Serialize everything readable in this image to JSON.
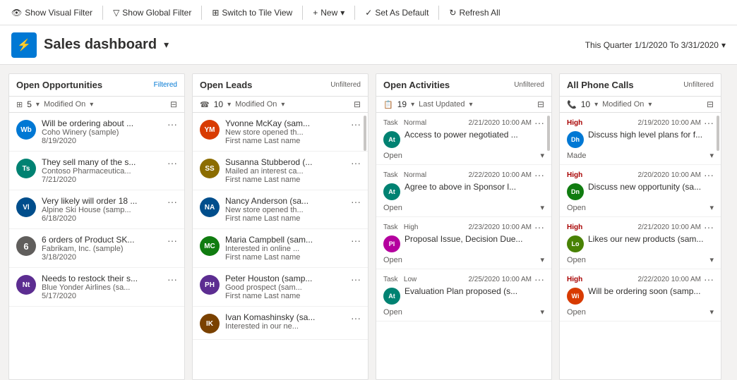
{
  "toolbar": {
    "show_visual_filter": "Show Visual Filter",
    "show_global_filter": "Show Global Filter",
    "switch_to_tile": "Switch to Tile View",
    "new": "New",
    "set_as_default": "Set As Default",
    "refresh_all": "Refresh All"
  },
  "header": {
    "title": "Sales dashboard",
    "date_range": "This Quarter 1/1/2020 To 3/31/2020"
  },
  "columns": {
    "opportunities": {
      "title": "Open Opportunities",
      "badge": "Filtered",
      "count": "5",
      "sort_label": "Modified On",
      "items": [
        {
          "initials": "Wb",
          "color": "bg-blue",
          "title": "Will be ordering about ...",
          "company": "Coho Winery (sample)",
          "date": "8/19/2020"
        },
        {
          "initials": "Ts",
          "color": "bg-teal",
          "title": "They sell many of the s...",
          "company": "Contoso Pharmaceutica...",
          "date": "7/21/2020"
        },
        {
          "initials": "Vl",
          "color": "bg-darkblue",
          "title": "Very likely will order 18 ...",
          "company": "Alpine Ski House (samp...",
          "date": "6/18/2020"
        },
        {
          "initials": "6",
          "color": "bg-num",
          "title": "6 orders of Product SK...",
          "company": "Fabrikam, Inc. (sample)",
          "date": "3/18/2020"
        },
        {
          "initials": "Nt",
          "color": "bg-purple",
          "title": "Needs to restock their s...",
          "company": "Blue Yonder Airlines (sa...",
          "date": "5/17/2020"
        }
      ]
    },
    "leads": {
      "title": "Open Leads",
      "badge": "Unfiltered",
      "count": "10",
      "sort_label": "Modified On",
      "items": [
        {
          "initials": "YM",
          "color": "bg-orange",
          "name": "Yvonne McKay (sam...",
          "desc": "New store opened th...",
          "sub": "First name Last name"
        },
        {
          "initials": "SS",
          "color": "bg-olive",
          "name": "Susanna Stubberod (...",
          "desc": "Mailed an interest ca...",
          "sub": "First name Last name"
        },
        {
          "initials": "NA",
          "color": "bg-darkblue",
          "name": "Nancy Anderson (sa...",
          "desc": "New store opened th...",
          "sub": "First name Last name"
        },
        {
          "initials": "MC",
          "color": "bg-green",
          "name": "Maria Campbell (sam...",
          "desc": "Interested in online ...",
          "sub": "First name Last name"
        },
        {
          "initials": "PH",
          "color": "bg-purple",
          "name": "Peter Houston (samp...",
          "desc": "Good prospect (sam...",
          "sub": "First name Last name"
        },
        {
          "initials": "IK",
          "color": "bg-brown",
          "name": "Ivan Komashinsky (sa...",
          "desc": "Interested in our ne...",
          "sub": ""
        }
      ]
    },
    "activities": {
      "title": "Open Activities",
      "badge": "Unfiltered",
      "count": "19",
      "sort_label": "Last Updated",
      "items": [
        {
          "type": "Task  Normal",
          "date": "2/21/2020 10:00 AM",
          "initials": "At",
          "color": "bg-teal",
          "title": "Access to power negotiated ...",
          "status": "Open"
        },
        {
          "type": "Task  Normal",
          "date": "2/22/2020 10:00 AM",
          "initials": "At",
          "color": "bg-teal",
          "title": "Agree to above in Sponsor l...",
          "status": "Open"
        },
        {
          "type": "Task  High",
          "date": "2/23/2020 10:00 AM",
          "initials": "Pl",
          "color": "bg-pink",
          "title": "Proposal Issue, Decision Due...",
          "status": "Open"
        },
        {
          "type": "Task  Low",
          "date": "2/25/2020 10:00 AM",
          "initials": "At",
          "color": "bg-teal",
          "title": "Evaluation Plan proposed (s...",
          "status": "Open"
        }
      ]
    },
    "phone_calls": {
      "title": "All Phone Calls",
      "badge": "Unfiltered",
      "count": "10",
      "sort_label": "Modified On",
      "items": [
        {
          "priority": "High",
          "priority_class": "priority-high",
          "date": "2/19/2020 10:00 AM",
          "initials": "Dh",
          "color": "bg-blue",
          "title": "Discuss high level plans for f...",
          "status": "Made"
        },
        {
          "priority": "High",
          "priority_class": "priority-high",
          "date": "2/20/2020 10:00 AM",
          "initials": "Dn",
          "color": "bg-green",
          "title": "Discuss new opportunity (sa...",
          "status": "Open"
        },
        {
          "priority": "High",
          "priority_class": "priority-high",
          "date": "2/21/2020 10:00 AM",
          "initials": "Lo",
          "color": "bg-lime",
          "title": "Likes our new products (sam...",
          "status": "Open"
        },
        {
          "priority": "High",
          "priority_class": "priority-high",
          "date": "2/22/2020 10:00 AM",
          "initials": "Wi",
          "color": "bg-orange",
          "title": "Will be ordering soon (samp...",
          "status": "Open"
        }
      ]
    }
  }
}
